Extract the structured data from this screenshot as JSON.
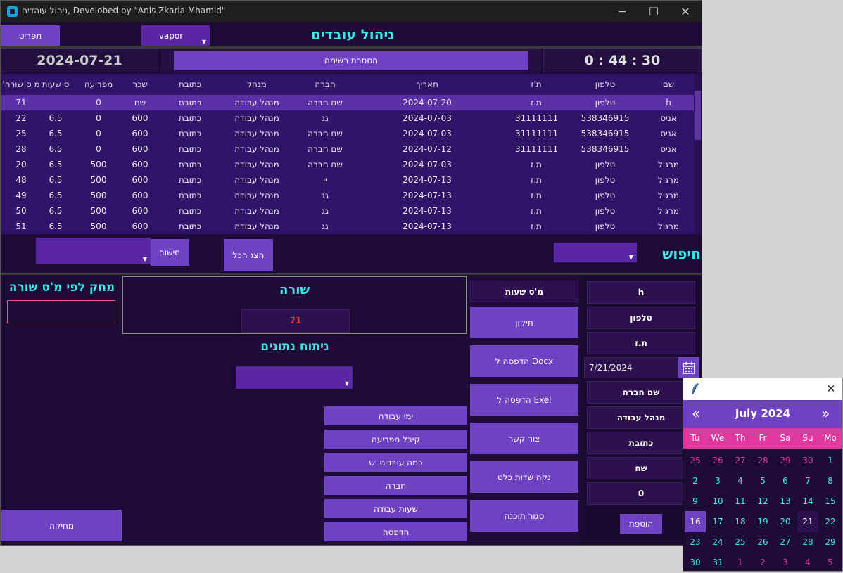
{
  "window": {
    "title": "ניהול עוהדים, Develobed by \"Anis Zkaria Mhamid\"",
    "minimize": "─",
    "maximize": "☐",
    "close": "✕"
  },
  "topbar": {
    "menu_label": "תפריט",
    "theme": "vapor",
    "app_heading": "ניהול עובדים"
  },
  "status": {
    "date": "2024-07-21",
    "hide_list_label": "הסתרת רשימה",
    "clock": "0 : 44 : 30"
  },
  "table": {
    "columns": [
      "שם",
      "טלפון",
      "ת'ז",
      "תאריך",
      "חברה",
      "מנהל",
      "כתובת",
      "שכר",
      "מפריעה",
      "ס שעות",
      "'מ ס שורה"
    ],
    "rows": [
      [
        "h",
        "טלפון",
        "ת.ז",
        "2024-07-20",
        "שם חברה",
        "מנהל עבודה",
        "כתובת",
        "שח",
        "0",
        "",
        "71"
      ],
      [
        "אניס",
        "538346915",
        "31111111",
        "2024-07-03",
        "גג",
        "מנהל עבודה",
        "כתובת",
        "600",
        "0",
        "6.5",
        "22"
      ],
      [
        "אניס",
        "538346915",
        "31111111",
        "2024-07-03",
        "שם חברה",
        "מנהל עבודה",
        "כתובת",
        "600",
        "0",
        "6.5",
        "25"
      ],
      [
        "אניס",
        "538346915",
        "31111111",
        "2024-07-12",
        "שם חברה",
        "מנהל עבודה",
        "כתובת",
        "600",
        "0",
        "6.5",
        "28"
      ],
      [
        "מרגול",
        "טלפון",
        "ת.ז",
        "2024-07-03",
        "שם חברה",
        "מנהל עבודה",
        "כתובת",
        "600",
        "500",
        "6.5",
        "20"
      ],
      [
        "מרגול",
        "טלפון",
        "ת.ז",
        "2024-07-13",
        "יי",
        "מנהל עבודה",
        "כתובת",
        "600",
        "500",
        "6.5",
        "48"
      ],
      [
        "מרגול",
        "טלפון",
        "ת.ז",
        "2024-07-13",
        "גג",
        "מנהל עבודה",
        "כתובת",
        "600",
        "500",
        "6.5",
        "49"
      ],
      [
        "מרגול",
        "טלפון",
        "ת.ז",
        "2024-07-13",
        "גג",
        "מנהל עבודה",
        "כתובת",
        "600",
        "500",
        "6.5",
        "50"
      ],
      [
        "מרגול",
        "טלפון",
        "ת.ז",
        "2024-07-13",
        "גג",
        "מנהל עבודה",
        "כתובת",
        "600",
        "500",
        "6.5",
        "51"
      ]
    ],
    "selected_row": 0
  },
  "toolbar": {
    "calc_label": "חישוב",
    "show_all_label": "הצג הכל",
    "search_label": "חיפוש"
  },
  "delete_panel": {
    "heading": "מחק לפי מ'ס שורה",
    "delete_label": "מחיקה"
  },
  "row_panel": {
    "heading": "שורה",
    "value": "71"
  },
  "analysis": {
    "heading": "ניתוח נתונים",
    "buttons": [
      "ימי עבודה",
      "קיבל מפריעה",
      "כמה עובדים יש",
      "חברה",
      "שעות עבודה",
      "הדפסה"
    ]
  },
  "actions": {
    "hours_label": "מ'ס שעות",
    "fix": "תיקון",
    "print_docx": "הדפסה ל Docx",
    "print_excel": "הדפסה ל Exel",
    "contact": "צור קשר",
    "clear": "נקה שדות כלט",
    "exit": "סגור תוכנה"
  },
  "form": {
    "name": "h",
    "phone": "טלפון",
    "id": "ת.ז",
    "date": "7/21/2024",
    "company": "שם חברה",
    "manager": "מנהל עבודה",
    "address": "כתובת",
    "salary": "שח",
    "bonus": "0",
    "add_label": "הוספת"
  },
  "calendar": {
    "month_title": "July 2024",
    "prev": "«",
    "next": "»",
    "close": "✕",
    "weekdays": [
      "Tu",
      "We",
      "Th",
      "Fr",
      "Sa",
      "Su",
      "Mo"
    ],
    "weeks": [
      [
        "25",
        "26",
        "27",
        "28",
        "29",
        "30",
        "1"
      ],
      [
        "2",
        "3",
        "4",
        "5",
        "6",
        "7",
        "8"
      ],
      [
        "9",
        "10",
        "11",
        "12",
        "13",
        "14",
        "15"
      ],
      [
        "16",
        "17",
        "18",
        "19",
        "20",
        "21",
        "22"
      ],
      [
        "23",
        "24",
        "25",
        "26",
        "27",
        "28",
        "29"
      ],
      [
        "30",
        "31",
        "1",
        "2",
        "3",
        "4",
        "5"
      ]
    ],
    "selected_day": "21",
    "highlighted_day": "16"
  },
  "colors": {
    "accent": "#6f42c1",
    "cyan": "#3ee6e6",
    "pink": "#e0389f",
    "background": "#1e0c36",
    "row_value": "#e53935"
  }
}
